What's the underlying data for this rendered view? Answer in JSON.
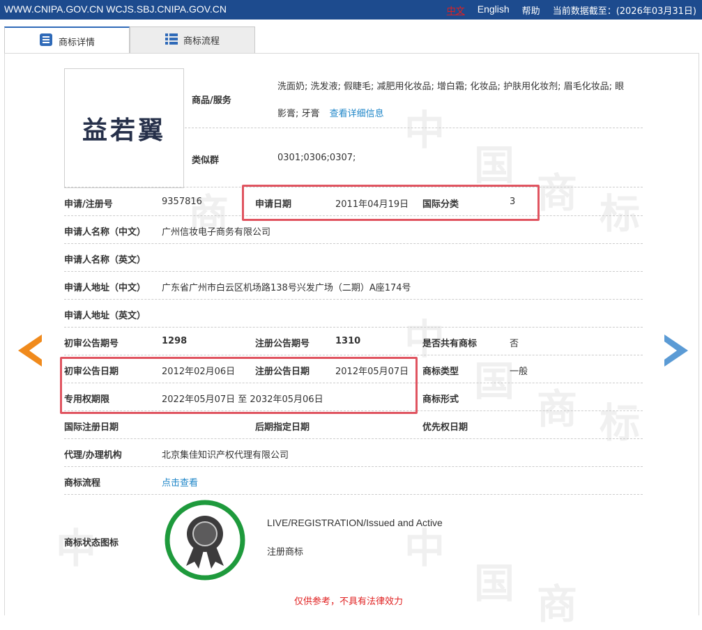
{
  "topbar": {
    "site": "WWW.CNIPA.GOV.CN WCJS.SBJ.CNIPA.GOV.CN",
    "lang_cn": "中文",
    "lang_en": "English",
    "help": "帮助",
    "data_date": "当前数据截至：(2026年03月31日)"
  },
  "tabs": {
    "detail": "商标详情",
    "process": "商标流程"
  },
  "logo_text": "益若翼",
  "goods": {
    "label": "商品/服务",
    "line1": "洗面奶; 洗发液; 假睫毛; 减肥用化妆品; 增白霜; 化妆品; 护肤用化妆剂; 眉毛化妆品; 眼",
    "line2": "影膏; 牙膏",
    "more": "查看详细信息"
  },
  "similar": {
    "label": "类似群",
    "value": "0301;0306;0307;"
  },
  "fields": {
    "reg_no_label": "申请/注册号",
    "reg_no": "9357816",
    "app_date_label": "申请日期",
    "app_date": "2011年04月19日",
    "intl_class_label": "国际分类",
    "intl_class": "3",
    "applicant_cn_label": "申请人名称（中文）",
    "applicant_cn": "广州信妆电子商务有限公司",
    "applicant_en_label": "申请人名称（英文）",
    "addr_cn_label": "申请人地址（中文）",
    "addr_cn": "广东省广州市白云区机场路138号兴发广场（二期）A座174号",
    "addr_en_label": "申请人地址（英文）",
    "prelim_no_label": "初审公告期号",
    "prelim_no": "1298",
    "reg_ann_no_label": "注册公告期号",
    "reg_ann_no": "1310",
    "shared_label": "是否共有商标",
    "shared": "否",
    "prelim_date_label": "初审公告日期",
    "prelim_date": "2012年02月06日",
    "reg_ann_date_label": "注册公告日期",
    "reg_ann_date": "2012年05月07日",
    "tm_type_label": "商标类型",
    "tm_type": "一般",
    "exclusive_label": "专用权期限",
    "exclusive": "2022年05月07日 至 2032年05月06日",
    "tm_form_label": "商标形式",
    "intl_reg_label": "国际注册日期",
    "later_label": "后期指定日期",
    "priority_label": "优先权日期",
    "agent_label": "代理/办理机构",
    "agent": "北京集佳知识产权代理有限公司",
    "process_label": "商标流程",
    "process_link": "点击查看",
    "status_label": "商标状态图标",
    "status_en": "LIVE/REGISTRATION/Issued and Active",
    "status_cn": "注册商标"
  },
  "notice": "仅供参考，不具有法律效力",
  "colors": {
    "topbar": "#1d4b8e",
    "highlight": "#e05460",
    "link": "#1f86c8",
    "prev_arrow": "#f08a1c",
    "next_arrow": "#5b9bd5",
    "badge_ring": "#1e9a3c"
  },
  "icons": {
    "prev": "prev-arrow-icon",
    "next": "next-arrow-icon",
    "detail_tab": "list-icon",
    "process_tab": "grid-list-icon",
    "status": "registered-ribbon-icon"
  }
}
